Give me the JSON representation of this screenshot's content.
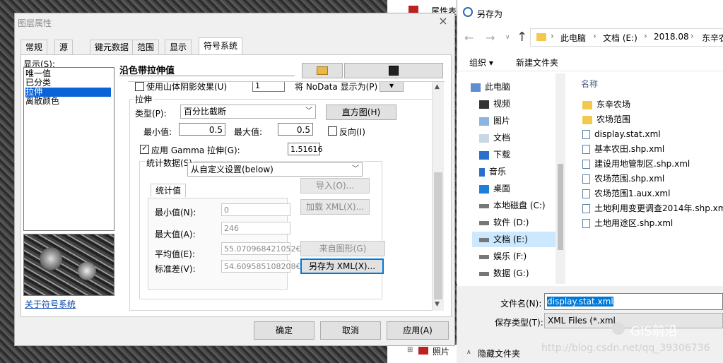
{
  "layer_dialog": {
    "title": "图层属性",
    "close_glyph": "×",
    "tabs": [
      "常规",
      "源",
      "键元数据",
      "范围",
      "显示",
      "符号系统"
    ],
    "show_label": "显示(S):",
    "show_items": [
      "唯一值",
      "已分类",
      "拉伸",
      "离散颜色"
    ],
    "selected_index": 2,
    "renderer_heading": "沿色带拉伸值",
    "about_link": "关于符号系统",
    "hillshade_label": "使用山体阴影效果(U)",
    "hillshade_z": "1",
    "nodata_label": "将 NoData 显示为(P)",
    "stretch_group": "拉伸",
    "type_label": "类型(P):",
    "type_value": "百分比截断",
    "histogram_button": "直方图(H)",
    "min_label": "最小值:",
    "min_value": "0.5",
    "max_label": "最大值:",
    "max_value": "0.5",
    "invert_label": "反向(I)",
    "gamma_label": "应用 Gamma 拉伸(G):",
    "gamma_value": "1.51616",
    "stats_label": "统计数据(S)",
    "stats_dropdown": "从自定义设置(below)",
    "stats_tab": "统计值",
    "stats_fields": [
      {
        "label": "最小值(N):",
        "value": "0"
      },
      {
        "label": "最大值(A):",
        "value": "246"
      },
      {
        "label": "平均值(E):",
        "value": "55.070968421052€"
      },
      {
        "label": "标准差(V):",
        "value": "54.609585108208€"
      }
    ],
    "import_button": "导入(O)...",
    "load_xml_button": "加载 XML(X)...",
    "from_graphic_button": "来自图形(G)",
    "save_xml_button": "另存为 XML(X)...",
    "ok_button": "确定",
    "cancel_button": "取消",
    "apply_button": "应用(A)"
  },
  "save_dialog": {
    "title": "另存为",
    "path": [
      "此电脑",
      "文档 (E:)",
      "2018.08",
      "东辛农"
    ],
    "organize": "组织 ▾",
    "new_folder": "新建文件夹",
    "column_name": "名称",
    "nav": [
      {
        "label": "此电脑",
        "icon": "computer-icon"
      },
      {
        "label": "视频",
        "icon": "video-icon"
      },
      {
        "label": "图片",
        "icon": "pictures-icon"
      },
      {
        "label": "文档",
        "icon": "documents-icon"
      },
      {
        "label": "下载",
        "icon": "download-icon"
      },
      {
        "label": "音乐",
        "icon": "music-icon"
      },
      {
        "label": "桌面",
        "icon": "desktop-icon"
      },
      {
        "label": "本地磁盘 (C:)",
        "icon": "drive-icon"
      },
      {
        "label": "软件 (D:)",
        "icon": "drive-icon"
      },
      {
        "label": "文档 (E:)",
        "icon": "drive-icon"
      },
      {
        "label": "娱乐 (F:)",
        "icon": "drive-icon"
      },
      {
        "label": "数据 (G:)",
        "icon": "drive-icon"
      }
    ],
    "nav_selected": 9,
    "files": [
      {
        "name": "东辛农场",
        "kind": "folder"
      },
      {
        "name": "农场范围",
        "kind": "folder"
      },
      {
        "name": "display.stat.xml",
        "kind": "file"
      },
      {
        "name": "基本农田.shp.xml",
        "kind": "file"
      },
      {
        "name": "建设用地管制区.shp.xml",
        "kind": "file"
      },
      {
        "name": "农场范围.shp.xml",
        "kind": "file"
      },
      {
        "name": "农场范围1.aux.xml",
        "kind": "file"
      },
      {
        "name": "土地利用变更调查2014年.shp.xml",
        "kind": "file"
      },
      {
        "name": "土地用途区.shp.xml",
        "kind": "file"
      }
    ],
    "filename_label": "文件名(N):",
    "filename_value": "display.stat.xml",
    "savetype_label": "保存类型(T):",
    "savetype_value": "XML Files (*.xml",
    "hide_folders": "隐藏文件夹"
  },
  "background_labels": {
    "top_item": "属性表",
    "bottom_item": "照片"
  },
  "watermark": {
    "brand": "GIS前沿",
    "url": "http://blog.csdn.net/qq_39306736"
  }
}
